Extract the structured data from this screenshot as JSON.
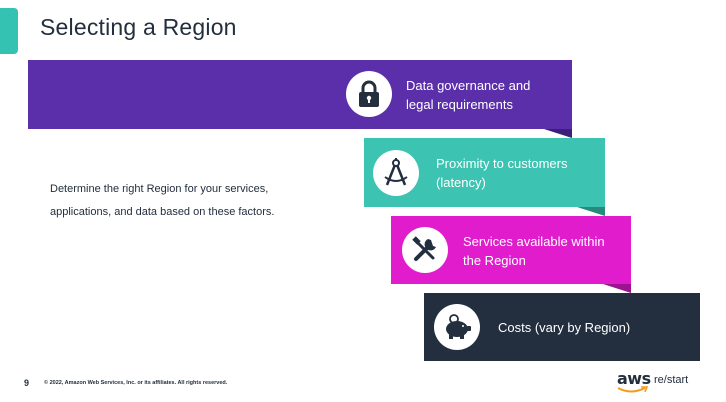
{
  "slide": {
    "title": "Selecting a Region",
    "body_lines": [
      "Determine the right Region for your services,",
      "applications, and data based on these factors."
    ],
    "factors": [
      {
        "line1": "Data governance and",
        "line2": "legal requirements",
        "icon": "lock-icon",
        "color": "#5a2fa9"
      },
      {
        "line1": "Proximity to customers",
        "line2": "(latency)",
        "icon": "compass-icon",
        "color": "#3cc3b2"
      },
      {
        "line1": "Services available within",
        "line2": "the Region",
        "icon": "tools-icon",
        "color": "#e01ccd"
      },
      {
        "line1": "Costs (vary by Region)",
        "line2": "",
        "icon": "piggy-bank-icon",
        "color": "#232f3e"
      }
    ]
  },
  "footer": {
    "page_number": "9",
    "copyright": "© 2022, Amazon Web Services, Inc. or its affiliates. All rights reserved.",
    "logo_aws": "aws",
    "logo_restart": "re/start"
  }
}
